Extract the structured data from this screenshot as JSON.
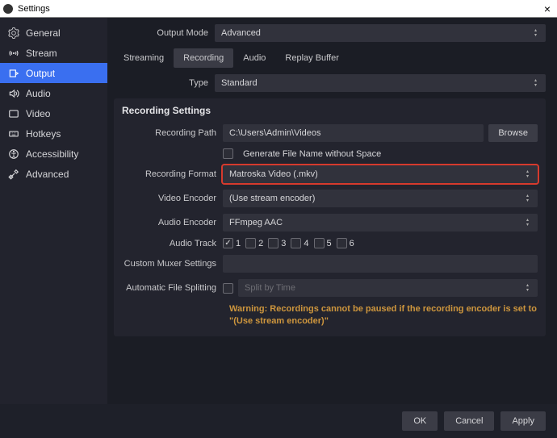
{
  "window": {
    "title": "Settings",
    "close": "×"
  },
  "sidebar": {
    "items": [
      {
        "label": "General"
      },
      {
        "label": "Stream"
      },
      {
        "label": "Output"
      },
      {
        "label": "Audio"
      },
      {
        "label": "Video"
      },
      {
        "label": "Hotkeys"
      },
      {
        "label": "Accessibility"
      },
      {
        "label": "Advanced"
      }
    ]
  },
  "outputMode": {
    "label": "Output Mode",
    "value": "Advanced"
  },
  "tabs": [
    {
      "label": "Streaming"
    },
    {
      "label": "Recording"
    },
    {
      "label": "Audio"
    },
    {
      "label": "Replay Buffer"
    }
  ],
  "type": {
    "label": "Type",
    "value": "Standard"
  },
  "panel": {
    "title": "Recording Settings"
  },
  "recPath": {
    "label": "Recording Path",
    "value": "C:\\Users\\Admin\\Videos",
    "browse": "Browse"
  },
  "genName": {
    "label": "Generate File Name without Space"
  },
  "recFormat": {
    "label": "Recording Format",
    "value": "Matroska Video (.mkv)"
  },
  "vEncoder": {
    "label": "Video Encoder",
    "value": "(Use stream encoder)"
  },
  "aEncoder": {
    "label": "Audio Encoder",
    "value": "FFmpeg AAC"
  },
  "aTrack": {
    "label": "Audio Track",
    "t1": "1",
    "t2": "2",
    "t3": "3",
    "t4": "4",
    "t5": "5",
    "t6": "6"
  },
  "muxer": {
    "label": "Custom Muxer Settings"
  },
  "split": {
    "label": "Automatic File Splitting",
    "value": "Split by Time"
  },
  "warning": "Warning: Recordings cannot be paused if the recording encoder is set to \"(Use stream encoder)\"",
  "footer": {
    "ok": "OK",
    "cancel": "Cancel",
    "apply": "Apply"
  }
}
